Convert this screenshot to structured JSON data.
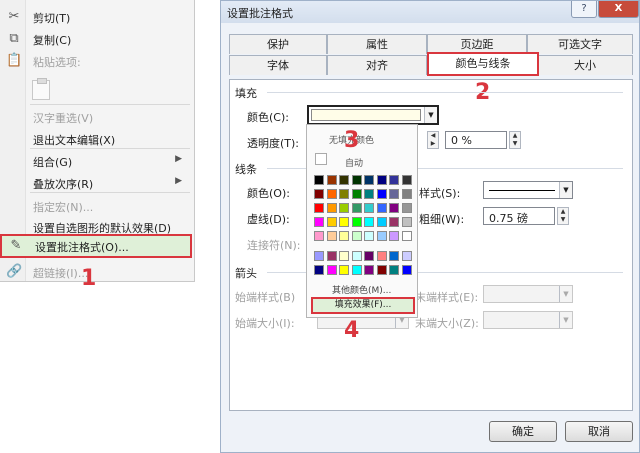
{
  "context_menu": {
    "items": [
      {
        "label": "剪切(T)",
        "icon": "scissors-icon",
        "disabled": false
      },
      {
        "label": "复制(C)",
        "icon": "copy-icon",
        "disabled": false
      },
      {
        "label": "粘贴选项:",
        "icon": "paste-icon",
        "disabled": true
      },
      {
        "label": "汉字重选(V)",
        "disabled": true
      },
      {
        "label": "退出文本编辑(X)",
        "disabled": false
      },
      {
        "label": "组合(G)",
        "disabled": false,
        "submenu": true
      },
      {
        "label": "叠放次序(R)",
        "disabled": false,
        "submenu": true
      },
      {
        "label": "指定宏(N)...",
        "disabled": true
      },
      {
        "label": "设置自选图形的默认效果(D)",
        "disabled": false
      },
      {
        "label": "设置批注格式(O)...",
        "icon": "format-comment-icon",
        "disabled": false,
        "selected": true
      },
      {
        "label": "超链接(I)...",
        "icon": "hyperlink-icon",
        "disabled": true
      }
    ],
    "submenu_glyph": "▶"
  },
  "dialog": {
    "title": "设置批注格式",
    "help_label": "?",
    "close_label": "X",
    "tabs_back": [
      "保护",
      "属性",
      "页边距",
      "可选文字"
    ],
    "tabs_front": [
      "字体",
      "对齐",
      "颜色与线条",
      "大小"
    ],
    "active_tab": "颜色与线条",
    "fill_section": "填充",
    "fill_color_label": "颜色(C):",
    "transparency_label": "透明度(T):",
    "transparency_value": "0 %",
    "line_section": "线条",
    "line_color_label": "颜色(O):",
    "dash_label": "虚线(D):",
    "connector_label": "连接符(N):",
    "style_label": "样式(S):",
    "weight_label": "粗细(W):",
    "weight_value": "0.75 磅",
    "arrows_section": "箭头",
    "begin_style_label": "始端样式(B)",
    "begin_size_label": "始端大小(I):",
    "end_style_label": "末端样式(E):",
    "end_size_label": "末端大小(Z):",
    "ok_label": "确定",
    "cancel_label": "取消",
    "fill_color": "#fffde8"
  },
  "color_palette": {
    "no_fill_label": "无填充颜色",
    "auto_label": "自动",
    "more_colors_label": "其他颜色(M)...",
    "fill_effects_label": "填充效果(F)...",
    "rows": [
      [
        "#000000",
        "#993300",
        "#333300",
        "#003300",
        "#003366",
        "#000080",
        "#333399",
        "#333333"
      ],
      [
        "#800000",
        "#ff6600",
        "#808000",
        "#008000",
        "#008080",
        "#0000ff",
        "#666699",
        "#808080"
      ],
      [
        "#ff0000",
        "#ff9900",
        "#99cc00",
        "#339966",
        "#33cccc",
        "#3366ff",
        "#800080",
        "#969696"
      ],
      [
        "#ff00ff",
        "#ffcc00",
        "#ffff00",
        "#00ff00",
        "#00ffff",
        "#00ccff",
        "#993366",
        "#c0c0c0"
      ],
      [
        "#ff99cc",
        "#ffcc99",
        "#ffff99",
        "#ccffcc",
        "#ccffff",
        "#99ccff",
        "#cc99ff",
        "#ffffff"
      ],
      [
        "#9999ff",
        "#993366",
        "#ffffcc",
        "#ccffff",
        "#660066",
        "#ff8080",
        "#0066cc",
        "#ccccff"
      ],
      [
        "#000080",
        "#ff00ff",
        "#ffff00",
        "#00ffff",
        "#800080",
        "#800000",
        "#008080",
        "#0000ff"
      ]
    ]
  },
  "annotations": [
    "1",
    "2",
    "3",
    "4"
  ],
  "colors": {
    "highlight": "#d9363e",
    "selected_bg": "#dff0d8"
  }
}
